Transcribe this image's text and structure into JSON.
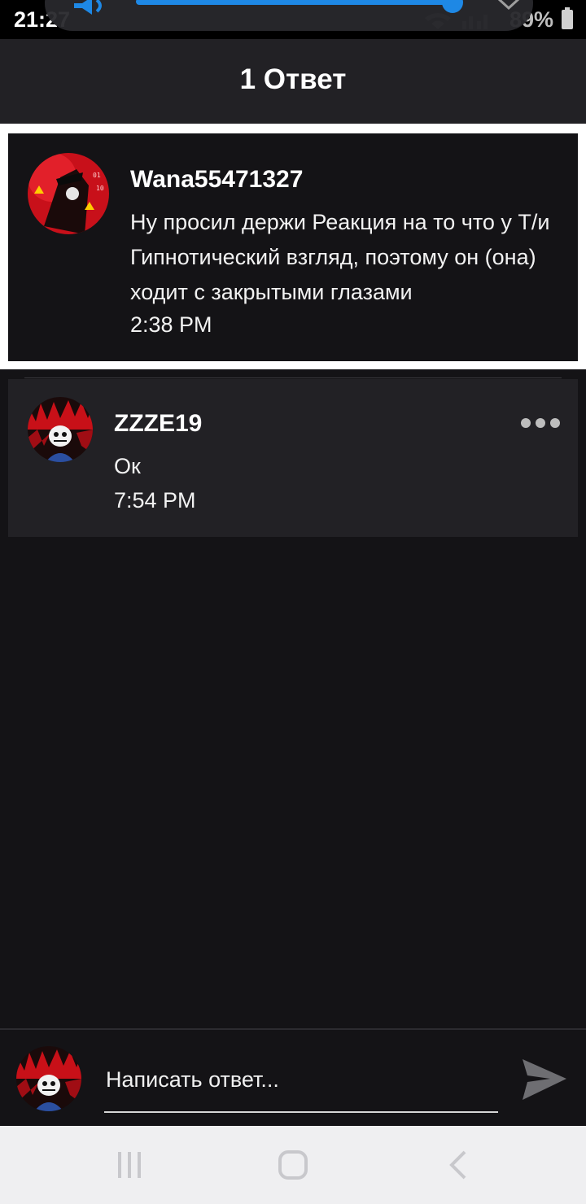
{
  "status_bar": {
    "time": "21:27",
    "battery": "89%"
  },
  "volume": {
    "level_percent": 100
  },
  "header": {
    "title": "1 Ответ"
  },
  "parent_comment": {
    "username": "Wana55471327",
    "text": "Ну просил держи Реакция на то что у Т/и Гипнотический взгляд, поэтому он (она)  ходит с закрытыми глазами",
    "time": "2:38 PM"
  },
  "replies": [
    {
      "username": "ZZZE19",
      "text": "Ок",
      "time": "7:54 PM"
    }
  ],
  "compose": {
    "placeholder": "Написать ответ..."
  },
  "colors": {
    "background": "#141316",
    "header": "#222125",
    "accent_volume": "#1e88e5"
  }
}
